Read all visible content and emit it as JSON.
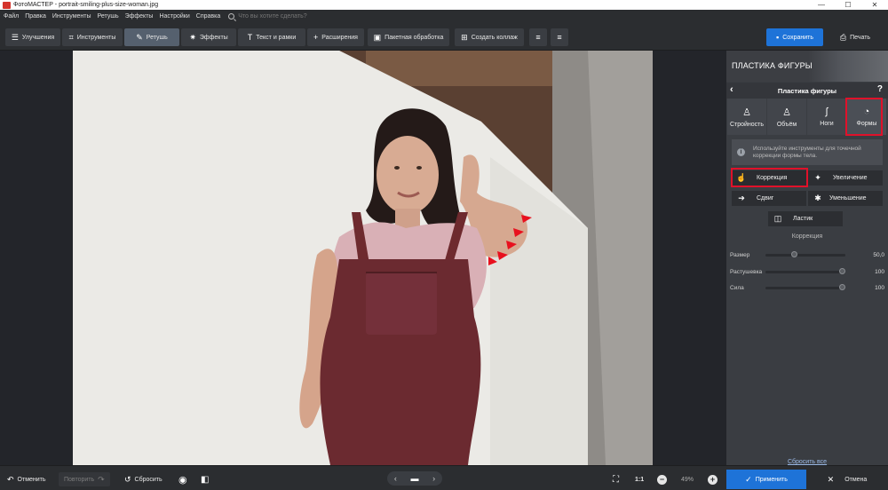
{
  "window": {
    "title": "ФотоМАСТЕР - portrait-smiling-plus-size-woman.jpg",
    "controls": [
      "—",
      "☐",
      "✕"
    ]
  },
  "menu": {
    "items": [
      "Файл",
      "Правка",
      "Инструменты",
      "Ретушь",
      "Эффекты",
      "Настройки",
      "Справка"
    ],
    "search_placeholder": "Что вы хотите сделать?"
  },
  "toolbar": {
    "tabs": [
      {
        "label": "Улучшения",
        "icon": "sliders-icon"
      },
      {
        "label": "Инструменты",
        "icon": "crop-icon"
      },
      {
        "label": "Ретушь",
        "icon": "brush-icon"
      },
      {
        "label": "Эффекты",
        "icon": "sparkle-icon"
      },
      {
        "label": "Текст и рамки",
        "icon": "text-icon"
      },
      {
        "label": "Расширения",
        "icon": "plus-icon"
      },
      {
        "label": "Пакетная обработка",
        "icon": "images-icon"
      },
      {
        "label": "Создать коллаж",
        "icon": "grid-icon"
      }
    ],
    "active_tab": "Ретушь",
    "save_label": "Сохранить",
    "print_label": "Печать"
  },
  "panel": {
    "header_title": "ПЛАСТИКА ФИГУРЫ",
    "subheader": "Пластика фигуры",
    "tabs": [
      {
        "label": "Стройность",
        "icon": "body-slim-icon"
      },
      {
        "label": "Объём",
        "icon": "body-volume-icon"
      },
      {
        "label": "Ноги",
        "icon": "legs-icon"
      },
      {
        "label": "Формы",
        "icon": "shape-icon"
      }
    ],
    "selected_tab": "Формы",
    "info_text_line1": "Используйте инструменты для точечной",
    "info_text_line2": "коррекции формы тела.",
    "tools": [
      {
        "label": "Коррекция",
        "icon": "hand-icon"
      },
      {
        "label": "Увеличение",
        "icon": "expand-icon"
      },
      {
        "label": "Сдвиг",
        "icon": "shift-arrow-icon"
      },
      {
        "label": "Уменьшение",
        "icon": "shrink-icon"
      },
      {
        "label": "Ластик",
        "icon": "eraser-icon"
      }
    ],
    "selected_tool": "Коррекция",
    "section_label": "Коррекция",
    "sliders": [
      {
        "label": "Размер",
        "value": "50,0",
        "fraction": 0.33
      },
      {
        "label": "Растушевка",
        "value": "100",
        "fraction": 1.0
      },
      {
        "label": "Сила",
        "value": "100",
        "fraction": 1.0
      }
    ],
    "reset_all_label": "Сбросить все"
  },
  "bottom": {
    "undo_label": "Отменить",
    "redo_label": "Повторить",
    "reset_label": "Сбросить",
    "ratio_label": "1:1",
    "zoom_label": "49%",
    "apply_label": "Применить",
    "cancel_label": "Отмена"
  },
  "colors": {
    "accent": "#1e73d8",
    "highlight": "#e0112a",
    "panel_bg": "#3a3d42"
  }
}
